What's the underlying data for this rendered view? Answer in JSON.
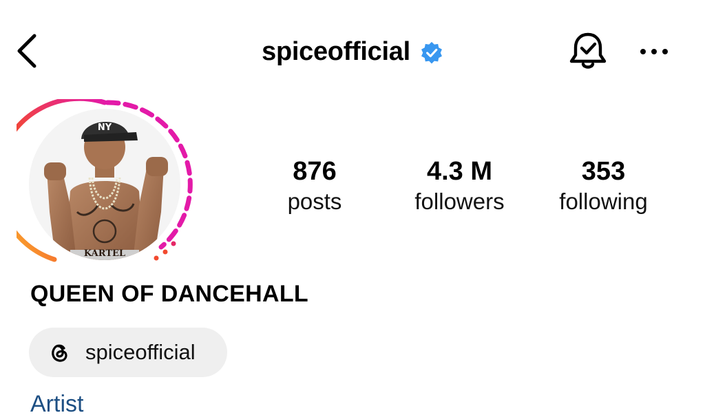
{
  "header": {
    "username": "spiceofficial",
    "verified": true,
    "icons": [
      "chevron-left-icon",
      "verified-badge-icon",
      "bell-check-icon",
      "more-horizontal-icon"
    ]
  },
  "stats": {
    "posts": {
      "value": "876",
      "label": "posts"
    },
    "followers": {
      "value": "4.3 M",
      "label": "followers"
    },
    "following": {
      "value": "353",
      "label": "following"
    }
  },
  "profile": {
    "display_name": "QUEEN OF DANCEHALL",
    "threads_handle": "spiceofficial",
    "category": "Artist",
    "avatar_cap_text": "NY",
    "avatar_tattoo_text": "KARTEL"
  },
  "colors": {
    "verified_blue": "#3897f0",
    "story_ring_start": "#fcc52c",
    "story_ring_mid": "#f24a2f",
    "story_ring_end": "#e31aa8",
    "link_blue": "#1d4f83",
    "chip_bg": "#efefef"
  }
}
